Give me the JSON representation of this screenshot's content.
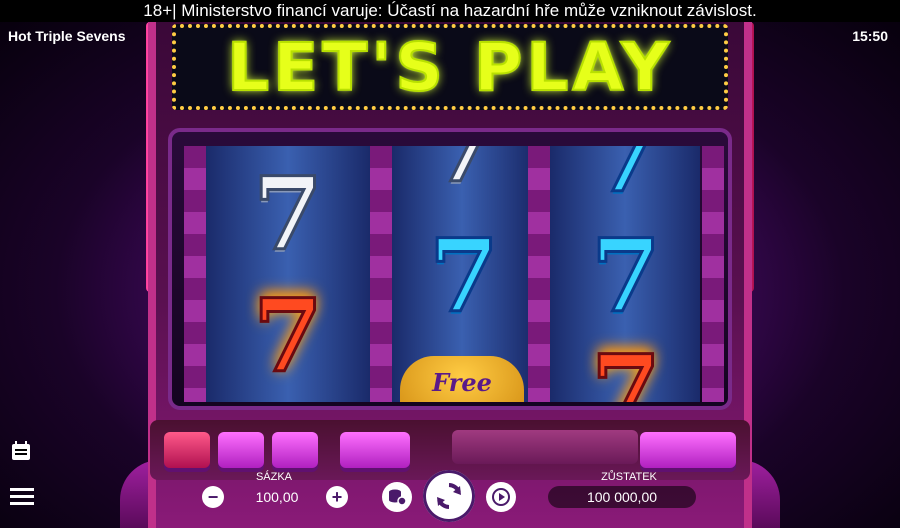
{
  "warning": "18+| Ministerstvo financí varuje: Účastí na hazardní hře může vzniknout závislost.",
  "game_title": "Hot Triple Sevens",
  "clock": "15:50",
  "marquee_text": "LET'S PLAY",
  "reels": [
    {
      "symbols": [
        "7",
        "7"
      ]
    },
    {
      "symbols": [
        "7",
        "7"
      ]
    },
    {
      "symbols": [
        "7",
        "7"
      ]
    }
  ],
  "free_label": "Free",
  "bet": {
    "label": "SÁZKA",
    "value": "100,00"
  },
  "balance": {
    "label": "ZŮSTATEK",
    "value": "100 000,00"
  },
  "icons": {
    "paytable": "paytable-icon",
    "menu": "menu-icon",
    "minus": "minus-icon",
    "plus": "plus-icon",
    "coins": "coins-settings-icon",
    "spin": "spin-icon",
    "autoplay": "autoplay-icon"
  }
}
